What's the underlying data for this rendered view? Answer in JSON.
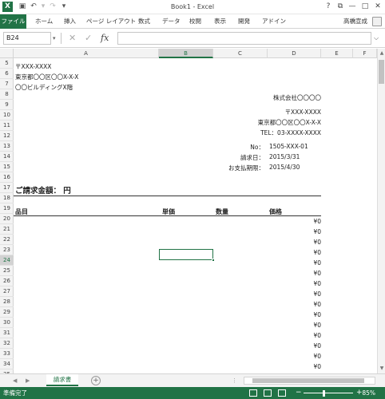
{
  "window": {
    "title": "Book1 - Excel",
    "app_icon": "X",
    "help": "?",
    "restore_ribbon": "⧉",
    "minimize": "—",
    "maximize": "□",
    "close": "✕"
  },
  "qat": {
    "save_icon": "💾",
    "undo_icon": "↶",
    "redo_icon": "↷",
    "customize_icon": "▾"
  },
  "ribbon": {
    "tabs": [
      "ファイル",
      "ホーム",
      "挿入",
      "ページ レイアウト",
      "数式",
      "データ",
      "校閲",
      "表示",
      "開発",
      "アドイン"
    ],
    "user": "高橋宣成"
  },
  "formula_bar": {
    "name_box": "B24",
    "formula": "",
    "fx": "fx",
    "cancel": "✕",
    "enter": "✓"
  },
  "columns": [
    "A",
    "B",
    "C",
    "D",
    "E",
    "F"
  ],
  "selected_column": "B",
  "rows": [
    "5",
    "6",
    "7",
    "8",
    "9",
    "10",
    "11",
    "12",
    "13",
    "14",
    "15",
    "16",
    "17",
    "18",
    "19",
    "20",
    "21",
    "22",
    "23",
    "24",
    "25",
    "26",
    "27",
    "28",
    "29",
    "30",
    "31",
    "32",
    "33",
    "34",
    "35"
  ],
  "selected_row": "24",
  "invoice": {
    "recipient_postal": "〒XXX-XXXX",
    "recipient_address": "東京都〇〇区〇〇X-X-X",
    "recipient_building": "〇〇ビルディングX階",
    "sender_company": "株式会社〇〇〇〇",
    "sender_postal": "〒XXX-XXXX",
    "sender_address": "東京都〇〇区〇〇X-X-X",
    "sender_tel": "TEL：03-XXXX-XXXX",
    "no_label": "No：",
    "no_value": "1505-XXX-01",
    "date_label": "請求日：",
    "date_value": "2015/3/31",
    "due_label": "お支払期限：",
    "due_value": "2015/4/30",
    "total_heading": "ご請求金額：  円",
    "col_item": "品目",
    "col_price": "単価",
    "col_qty": "数量",
    "col_amount": "価格",
    "amounts": [
      "¥0",
      "¥0",
      "¥0",
      "¥0",
      "¥0",
      "¥0",
      "¥0",
      "¥0",
      "¥0",
      "¥0",
      "¥0",
      "¥0",
      "¥0",
      "¥0",
      "¥0",
      "¥0"
    ]
  },
  "sheet_tabs": [
    "請求書"
  ],
  "status": {
    "ready": "準備完了",
    "zoom": "85%",
    "minus": "−",
    "plus": "+"
  }
}
